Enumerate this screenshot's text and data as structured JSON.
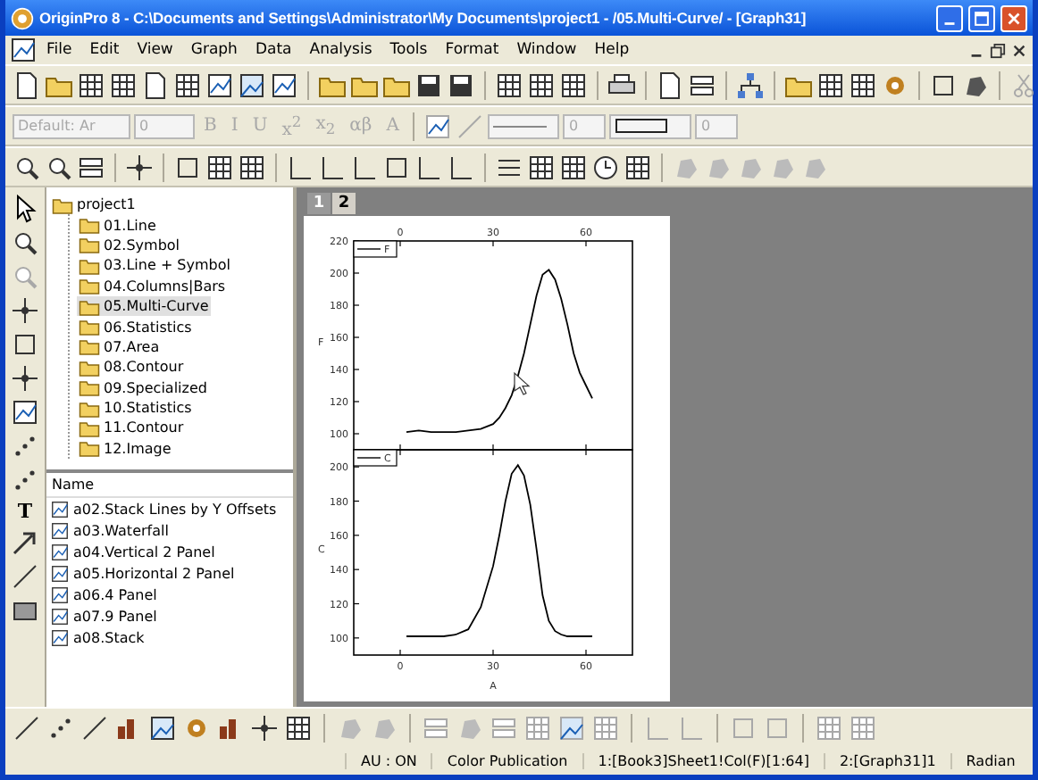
{
  "window": {
    "title": "OriginPro 8 - C:\\Documents and Settings\\Administrator\\My Documents\\project1 - /05.Multi-Curve/ - [Graph31]"
  },
  "menu": [
    "File",
    "Edit",
    "View",
    "Graph",
    "Data",
    "Analysis",
    "Tools",
    "Format",
    "Window",
    "Help"
  ],
  "format_toolbar": {
    "disabled": true,
    "font": "Default: Ar",
    "size": "0",
    "buttons": [
      "B",
      "I",
      "U",
      "x$^{2}$",
      "x$_{2}$",
      "αβ",
      "A"
    ],
    "line_size": "0",
    "border_size": "0"
  },
  "tools": {
    "text_tool": "T"
  },
  "project_tree": {
    "label": "project1",
    "children": [
      {
        "label": "01.Line",
        "selected": false
      },
      {
        "label": "02.Symbol",
        "selected": false
      },
      {
        "label": "03.Line + Symbol",
        "selected": false
      },
      {
        "label": "04.Columns|Bars",
        "selected": false
      },
      {
        "label": "05.Multi-Curve",
        "selected": true
      },
      {
        "label": "06.Statistics",
        "selected": false
      },
      {
        "label": "07.Area",
        "selected": false
      },
      {
        "label": "08.Contour",
        "selected": false
      },
      {
        "label": "09.Specialized",
        "selected": false
      },
      {
        "label": "10.Statistics",
        "selected": false
      },
      {
        "label": "11.Contour",
        "selected": false
      },
      {
        "label": "12.Image",
        "selected": false
      }
    ]
  },
  "file_list": {
    "header": "Name",
    "items": [
      "a02.Stack Lines by Y Offsets",
      "a03.Waterfall",
      "a04.Vertical 2 Panel",
      "a05.Horizontal 2 Panel",
      "a06.4 Panel",
      "a07.9 Panel",
      "a08.Stack"
    ]
  },
  "layer_tabs": [
    {
      "label": "1",
      "selected": true
    },
    {
      "label": "2",
      "selected": false
    }
  ],
  "graph": {
    "panels": [
      {
        "chart_data": {
          "type": "line",
          "ylabel": "F",
          "x": [
            2,
            6,
            10,
            14,
            18,
            22,
            26,
            30,
            32,
            34,
            36,
            38,
            40,
            42,
            44,
            46,
            48,
            50,
            52,
            54,
            56,
            58,
            60,
            62
          ],
          "series": [
            {
              "name": "F",
              "color": "#000000",
              "values": [
                101,
                102,
                101,
                101,
                101,
                102,
                103,
                106,
                110,
                116,
                124,
                136,
                150,
                168,
                186,
                199,
                202,
                196,
                184,
                168,
                150,
                138,
                130,
                122
              ]
            }
          ],
          "xlim": [
            -15,
            75
          ],
          "ylim": [
            90,
            220
          ],
          "xticks": [
            0,
            30,
            60
          ],
          "yticks": [
            100,
            120,
            140,
            160,
            180,
            200,
            220
          ]
        }
      },
      {
        "chart_data": {
          "type": "line",
          "xlabel": "A",
          "ylabel": "C",
          "x": [
            2,
            6,
            10,
            14,
            18,
            22,
            26,
            30,
            32,
            34,
            36,
            38,
            40,
            42,
            44,
            46,
            48,
            50,
            52,
            54,
            56,
            58,
            60,
            62
          ],
          "series": [
            {
              "name": "C",
              "color": "#000000",
              "values": [
                101,
                101,
                101,
                101,
                102,
                105,
                118,
                142,
                160,
                180,
                196,
                201,
                195,
                178,
                152,
                125,
                110,
                104,
                102,
                101,
                101,
                101,
                101,
                101
              ]
            }
          ],
          "xlim": [
            -15,
            75
          ],
          "ylim": [
            90,
            210
          ],
          "xticks": [
            0,
            30,
            60
          ],
          "yticks": [
            100,
            120,
            140,
            160,
            180,
            200
          ]
        }
      }
    ]
  },
  "status_bar": [
    "AU : ON",
    "Color Publication",
    "1:[Book3]Sheet1!Col(F)[1:64]",
    "2:[Graph31]1",
    "Radian"
  ]
}
